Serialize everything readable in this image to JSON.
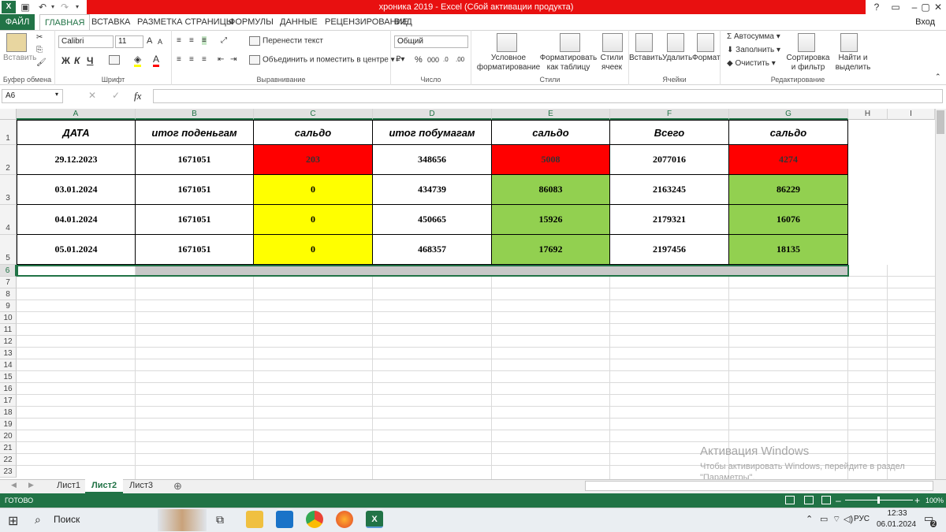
{
  "window": {
    "title": "хроника 2019 -  Excel (Сбой активации продукта)",
    "help": "?",
    "signin": "Вход"
  },
  "tabs": [
    "ФАЙЛ",
    "ГЛАВНАЯ",
    "ВСТАВКА",
    "РАЗМЕТКА СТРАНИЦЫ",
    "ФОРМУЛЫ",
    "ДАННЫЕ",
    "РЕЦЕНЗИРОВАНИЕ",
    "ВИД"
  ],
  "ribbon": {
    "clipboard": {
      "paste": "Вставить",
      "label": "Буфер обмена"
    },
    "font": {
      "name": "Calibri",
      "size": "11",
      "bold": "Ж",
      "italic": "К",
      "underline": "Ч",
      "label": "Шрифт",
      "grow": "A",
      "shrink": "A"
    },
    "alignment": {
      "wrap": "Перенести текст",
      "merge": "Объединить и поместить в центре",
      "label": "Выравнивание"
    },
    "number": {
      "format": "Общий",
      "percent": "%",
      "thousands": "000",
      "label": "Число"
    },
    "styles": {
      "conditional": "Условное форматирование",
      "as_table": "Форматировать как таблицу",
      "cell_styles": "Стили ячеек",
      "label": "Стили"
    },
    "cells": {
      "insert": "Вставить",
      "delete": "Удалить",
      "format": "Формат",
      "label": "Ячейки"
    },
    "editing": {
      "autosum": "Автосумма",
      "fill": "Заполнить",
      "clear": "Очистить",
      "sort": "Сортировка и фильтр",
      "find": "Найти и выделить",
      "label": "Редактирование"
    }
  },
  "formula_bar": {
    "name_box": "A6",
    "fx": "fx",
    "value": ""
  },
  "columns": [
    "A",
    "B",
    "C",
    "D",
    "E",
    "F",
    "G",
    "H",
    "I"
  ],
  "rows": [
    "1",
    "2",
    "3",
    "4",
    "5",
    "6",
    "7",
    "8",
    "9",
    "10",
    "11",
    "12",
    "13",
    "14",
    "15",
    "16",
    "17",
    "18",
    "19",
    "20",
    "21",
    "22",
    "23"
  ],
  "table": {
    "headers": [
      "ДАТА",
      "итог поденьгам",
      "сальдо",
      "итог побумагам",
      "сальдо",
      "Всего",
      "сальдо"
    ],
    "rows": [
      [
        "29.12.2023",
        "1671051",
        "203",
        "348656",
        "5008",
        "2077016",
        "4274"
      ],
      [
        "03.01.2024",
        "1671051",
        "0",
        "434739",
        "86083",
        "2163245",
        "86229"
      ],
      [
        "04.01.2024",
        "1671051",
        "0",
        "450665",
        "15926",
        "2179321",
        "16076"
      ],
      [
        "05.01.2024",
        "1671051",
        "0",
        "468357",
        "17692",
        "2197456",
        "18135"
      ]
    ],
    "fill_colors": {
      "red": "#ff0000",
      "yellow": "#ffff00",
      "green": "#92d050"
    }
  },
  "sheets": [
    "Лист1",
    "Лист2",
    "Лист3"
  ],
  "status": {
    "ready": "ГОТОВО",
    "zoom": "100%"
  },
  "watermark": {
    "title": "Активация Windows",
    "text": "Чтобы активировать Windows, перейдите в раздел \"Параметры\"."
  },
  "taskbar": {
    "search": "Поиск",
    "lang": "РУС",
    "time": "12:33",
    "date": "06.01.2024",
    "badge": "2"
  }
}
